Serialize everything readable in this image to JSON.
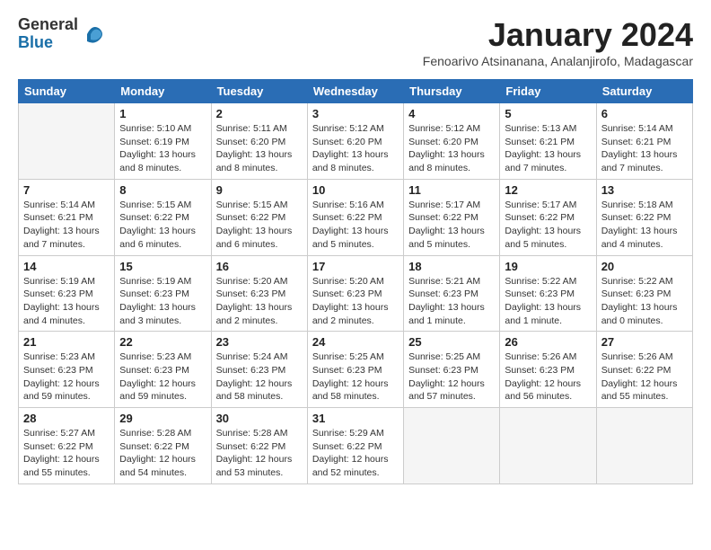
{
  "logo": {
    "text_general": "General",
    "text_blue": "Blue"
  },
  "header": {
    "month_title": "January 2024",
    "subtitle": "Fenoarivo Atsinanana, Analanjirofo, Madagascar"
  },
  "weekdays": [
    "Sunday",
    "Monday",
    "Tuesday",
    "Wednesday",
    "Thursday",
    "Friday",
    "Saturday"
  ],
  "weeks": [
    [
      {
        "day": "",
        "info": ""
      },
      {
        "day": "1",
        "info": "Sunrise: 5:10 AM\nSunset: 6:19 PM\nDaylight: 13 hours\nand 8 minutes."
      },
      {
        "day": "2",
        "info": "Sunrise: 5:11 AM\nSunset: 6:20 PM\nDaylight: 13 hours\nand 8 minutes."
      },
      {
        "day": "3",
        "info": "Sunrise: 5:12 AM\nSunset: 6:20 PM\nDaylight: 13 hours\nand 8 minutes."
      },
      {
        "day": "4",
        "info": "Sunrise: 5:12 AM\nSunset: 6:20 PM\nDaylight: 13 hours\nand 8 minutes."
      },
      {
        "day": "5",
        "info": "Sunrise: 5:13 AM\nSunset: 6:21 PM\nDaylight: 13 hours\nand 7 minutes."
      },
      {
        "day": "6",
        "info": "Sunrise: 5:14 AM\nSunset: 6:21 PM\nDaylight: 13 hours\nand 7 minutes."
      }
    ],
    [
      {
        "day": "7",
        "info": "Sunrise: 5:14 AM\nSunset: 6:21 PM\nDaylight: 13 hours\nand 7 minutes."
      },
      {
        "day": "8",
        "info": "Sunrise: 5:15 AM\nSunset: 6:22 PM\nDaylight: 13 hours\nand 6 minutes."
      },
      {
        "day": "9",
        "info": "Sunrise: 5:15 AM\nSunset: 6:22 PM\nDaylight: 13 hours\nand 6 minutes."
      },
      {
        "day": "10",
        "info": "Sunrise: 5:16 AM\nSunset: 6:22 PM\nDaylight: 13 hours\nand 5 minutes."
      },
      {
        "day": "11",
        "info": "Sunrise: 5:17 AM\nSunset: 6:22 PM\nDaylight: 13 hours\nand 5 minutes."
      },
      {
        "day": "12",
        "info": "Sunrise: 5:17 AM\nSunset: 6:22 PM\nDaylight: 13 hours\nand 5 minutes."
      },
      {
        "day": "13",
        "info": "Sunrise: 5:18 AM\nSunset: 6:22 PM\nDaylight: 13 hours\nand 4 minutes."
      }
    ],
    [
      {
        "day": "14",
        "info": "Sunrise: 5:19 AM\nSunset: 6:23 PM\nDaylight: 13 hours\nand 4 minutes."
      },
      {
        "day": "15",
        "info": "Sunrise: 5:19 AM\nSunset: 6:23 PM\nDaylight: 13 hours\nand 3 minutes."
      },
      {
        "day": "16",
        "info": "Sunrise: 5:20 AM\nSunset: 6:23 PM\nDaylight: 13 hours\nand 2 minutes."
      },
      {
        "day": "17",
        "info": "Sunrise: 5:20 AM\nSunset: 6:23 PM\nDaylight: 13 hours\nand 2 minutes."
      },
      {
        "day": "18",
        "info": "Sunrise: 5:21 AM\nSunset: 6:23 PM\nDaylight: 13 hours\nand 1 minute."
      },
      {
        "day": "19",
        "info": "Sunrise: 5:22 AM\nSunset: 6:23 PM\nDaylight: 13 hours\nand 1 minute."
      },
      {
        "day": "20",
        "info": "Sunrise: 5:22 AM\nSunset: 6:23 PM\nDaylight: 13 hours\nand 0 minutes."
      }
    ],
    [
      {
        "day": "21",
        "info": "Sunrise: 5:23 AM\nSunset: 6:23 PM\nDaylight: 12 hours\nand 59 minutes."
      },
      {
        "day": "22",
        "info": "Sunrise: 5:23 AM\nSunset: 6:23 PM\nDaylight: 12 hours\nand 59 minutes."
      },
      {
        "day": "23",
        "info": "Sunrise: 5:24 AM\nSunset: 6:23 PM\nDaylight: 12 hours\nand 58 minutes."
      },
      {
        "day": "24",
        "info": "Sunrise: 5:25 AM\nSunset: 6:23 PM\nDaylight: 12 hours\nand 58 minutes."
      },
      {
        "day": "25",
        "info": "Sunrise: 5:25 AM\nSunset: 6:23 PM\nDaylight: 12 hours\nand 57 minutes."
      },
      {
        "day": "26",
        "info": "Sunrise: 5:26 AM\nSunset: 6:23 PM\nDaylight: 12 hours\nand 56 minutes."
      },
      {
        "day": "27",
        "info": "Sunrise: 5:26 AM\nSunset: 6:22 PM\nDaylight: 12 hours\nand 55 minutes."
      }
    ],
    [
      {
        "day": "28",
        "info": "Sunrise: 5:27 AM\nSunset: 6:22 PM\nDaylight: 12 hours\nand 55 minutes."
      },
      {
        "day": "29",
        "info": "Sunrise: 5:28 AM\nSunset: 6:22 PM\nDaylight: 12 hours\nand 54 minutes."
      },
      {
        "day": "30",
        "info": "Sunrise: 5:28 AM\nSunset: 6:22 PM\nDaylight: 12 hours\nand 53 minutes."
      },
      {
        "day": "31",
        "info": "Sunrise: 5:29 AM\nSunset: 6:22 PM\nDaylight: 12 hours\nand 52 minutes."
      },
      {
        "day": "",
        "info": ""
      },
      {
        "day": "",
        "info": ""
      },
      {
        "day": "",
        "info": ""
      }
    ]
  ]
}
